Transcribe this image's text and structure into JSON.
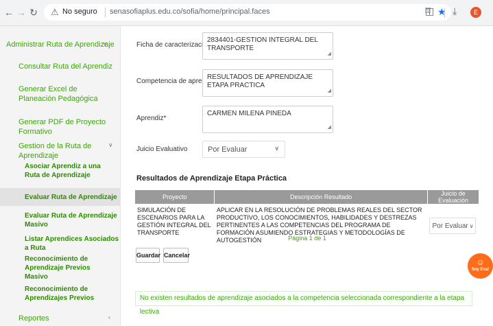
{
  "browser": {
    "insecure_label": "No seguro",
    "url": "senasofiaplus.edu.co/sofia/home/principal.faces",
    "profile_initial": "E"
  },
  "sidebar": {
    "administrar": "Administrar Ruta de Aprendizaje",
    "consultar": "Consultar Ruta del Aprendiz",
    "generar_excel": "Generar Excel de Planeación Pedagógica",
    "generar_pdf": "Generar PDF de Proyecto Formativo",
    "gestion": "Gestion de la Ruta de Aprendizaje",
    "sub": {
      "asociar": "Asociar Aprendiz a una Ruta de Aprendizaje",
      "evaluar": "Evaluar Ruta de Aprendizaje",
      "evaluar_masivo": "Evaluar Ruta de Aprendizaje Masivo",
      "listar": "Listar Aprendices Asociados a Ruta",
      "reconocimiento_masivo": "Reconocimiento de Aprendizaje Previos Masivo",
      "reconocimiento": "Reconocimiento de Aprendizajes Previos"
    },
    "reportes": "Reportes"
  },
  "form": {
    "ficha_label": "Ficha de caracterización*",
    "ficha_value": "2834401-GESTION INTEGRAL DEL TRANSPORTE",
    "competencia_label": "Competencia de aprendizaje*",
    "competencia_value": "RESULTADOS DE APRENDIZAJE ETAPA PRACTICA",
    "aprendiz_label": "Aprendiz*",
    "aprendiz_value": "CARMEN MILENA PINEDA",
    "juicio_label": "Juicio Evaluativo",
    "juicio_value": "Por Evaluar"
  },
  "results": {
    "title": "Resultados de Aprendizaje Etapa Práctica",
    "headers": [
      "Proyecto",
      "Descripción Resultado",
      "Juicio de Evaluación"
    ],
    "row": {
      "proyecto": "SIMULACIÓN DE ESCENARIOS PARA LA GESTIÓN INTEGRAL DEL TRANSPORTE",
      "descripcion": "APLICAR EN LA RESOLUCIÓN DE PROBLEMAS REALES DEL SECTOR PRODUCTIVO, LOS CONOCIMIENTOS, HABILIDADES Y DESTREZAS PERTINENTES A LAS COMPETENCIAS DEL PROGRAMA DE FORMACIÓN ASUMIENDO ESTRATEGIAS Y METODOLOGÍAS DE AUTOGESTIÓN",
      "juicio": "Por Evaluar"
    },
    "pager": "Página 1 de 1"
  },
  "buttons": {
    "guardar": "Guardar",
    "cancelar": "Cancelar"
  },
  "notice": "No existen resultados de aprendizaje asociados a la competencia seleccionada correspondiente a la etapa lectiva",
  "chatbot": {
    "label": "Soy Eva!"
  },
  "colors": {
    "accent": "#39a900",
    "header_gray": "#9a9a9a",
    "chatbot": "#ff6c1a"
  },
  "icons": [
    "back-icon",
    "forward-icon",
    "reload-icon",
    "warning-icon",
    "key-icon",
    "star-icon",
    "extensions-icon",
    "download-icon",
    "chevron-down-icon",
    "chevron-left-icon"
  ]
}
